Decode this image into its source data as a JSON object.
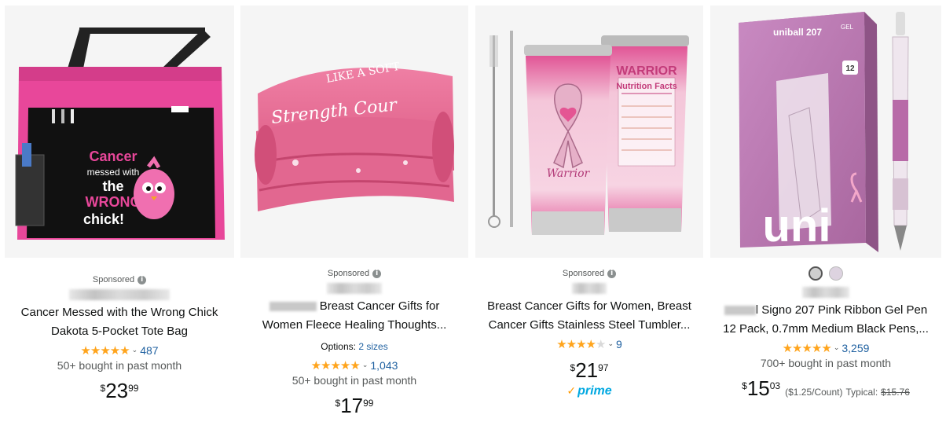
{
  "products": [
    {
      "sponsored": "Sponsored",
      "title_line1": "Cancer Messed with the Wrong Chick",
      "title_line2": "Dakota 5-Pocket Tote Bag",
      "rating_count": "487",
      "bought": "50+ bought in past month",
      "price": {
        "symbol": "$",
        "whole": "23",
        "fraction": "99"
      },
      "image_text": {
        "line1": "Cancer",
        "line2": "messed with",
        "line3": "the",
        "line4": "WRONG",
        "line5": "chick!"
      }
    },
    {
      "sponsored": "Sponsored",
      "title_line1": "Breast Cancer Gifts for",
      "title_line2": "Women Fleece Healing Thoughts...",
      "options_label": "Options:",
      "options_value": "2 sizes",
      "rating_count": "1,043",
      "bought": "50+ bought in past month",
      "price": {
        "symbol": "$",
        "whole": "17",
        "fraction": "99"
      },
      "image_text": {
        "line1": "LIKE A SOFT",
        "line2": "Strength Cour"
      }
    },
    {
      "sponsored": "Sponsored",
      "title_line1": "Breast Cancer Gifts for Women, Breast",
      "title_line2": "Cancer Gifts Stainless Steel Tumbler...",
      "rating_count": "9",
      "price": {
        "symbol": "$",
        "whole": "21",
        "fraction": "97"
      },
      "prime": "prime",
      "image_text": {
        "warrior": "WARRIOR",
        "nutrition": "Nutrition Facts",
        "script": "Warrior"
      }
    },
    {
      "title_line1": "l Signo 207 Pink Ribbon Gel Pen",
      "title_line2": "12 Pack, 0.7mm Medium Black Pens,...",
      "rating_count": "3,259",
      "bought": "700+ bought in past month",
      "price": {
        "symbol": "$",
        "whole": "15",
        "fraction": "03"
      },
      "unit_price": "($1.25/Count)",
      "typical_label": "Typical:",
      "typical_price": "$15.76",
      "image_text": {
        "brand_top": "uniball 207",
        "gel": "GEL",
        "big": "uni",
        "count": "12"
      }
    }
  ],
  "colors": {
    "star": "#ffa41c",
    "link": "#2162a1",
    "prime": "#00a8e1",
    "pink": "#e84f97"
  }
}
